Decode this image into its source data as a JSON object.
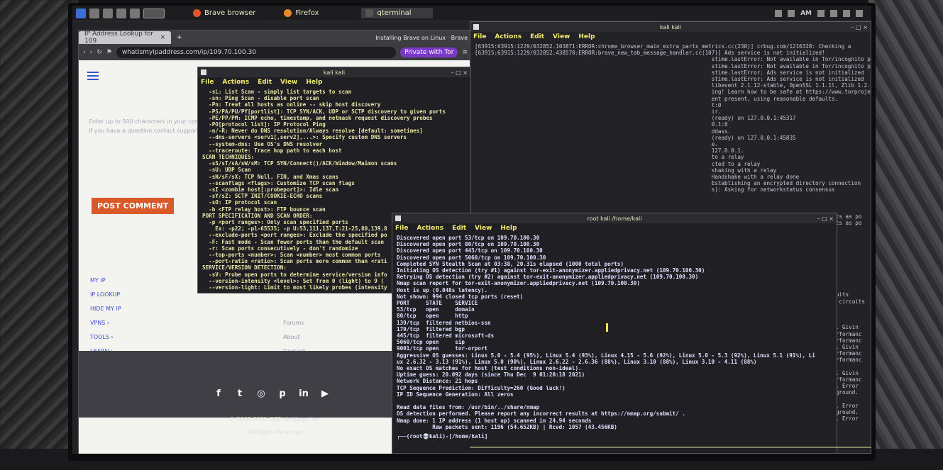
{
  "taskbar": {
    "tasks": [
      {
        "label": "Brave browser",
        "color": "#e2572a"
      },
      {
        "label": "Firefox",
        "color": "#e48a2b"
      },
      {
        "label": "qterminal",
        "color": "#444"
      }
    ],
    "clock": "AM",
    "subtitle": "Installing Brave on Linux · Brave"
  },
  "browser": {
    "tab_title": "IP Address Lookup for 109",
    "url": "whatismyipaddress.com/ip/109.70.100.30",
    "private_label": "Private with Tor",
    "page": {
      "hint_line1": "Enter up to 500 characters in your comment",
      "hint_line2": "If you have a question contact support",
      "post_button": "POST COMMENT",
      "nav": [
        "MY IP",
        "IP LOOKUP",
        "HIDE MY IP",
        "VPNS ›",
        "TOOLS ›",
        "LEARN ›"
      ],
      "nav2": [
        "Forums",
        "About",
        "Contact"
      ],
      "social_icons": [
        "facebook-icon",
        "twitter-icon",
        "instagram-icon",
        "pinterest-icon",
        "linkedin-icon",
        "youtube-icon"
      ],
      "social_glyphs": [
        "f",
        "t",
        "◎",
        "p",
        "in",
        "▶"
      ],
      "copyright": "© 2000-2021 CGP Holdings, Inc.",
      "rights": "All Rights Reserved"
    }
  },
  "terminal_menu": [
    "File",
    "Actions",
    "Edit",
    "View",
    "Help"
  ],
  "term_right": {
    "title": "kali  kali",
    "log": "[63915:63915:1229/032852.103871:ERROR:chrome_browser_main_extra_parts_metrics.cc(230)] crbug.com/1216328: Checking a\n[63915:63915:1229/032852.438570:ERROR:brave_new_tab_message_handler.cc(107)] Ads service is not initialized!\n                                                                         stime.lastError: Not available in Tor/incognito prof\n                                                                         stime.lastError: Not available in Tor/incognito prof\n                                                                         stime.lastError: Ads service is not initialized\n                                                                         stime.lastError: Ads service is not initialized\n                                                                         libevent 2.1.12-stable, OpenSSL 1.1.1l, Zlib 1.2.11\n                                                                         ing! Learn how to be safe at https://www.torproject\n                                                                         ent present, using reasonable defaults.\n                                                                         t:0\n                                                                         ir.\n                                                                         (ready) on 127.0.0.1:45317\n                                                                         0.1:0\n                                                                         ddass.\n                                                                         (ready) on 127.0.0.1:45835\n                                                                         e.\n                                                                         127.0.0.1.\n                                                                         to a relay\n                                                                         cted to a relay\n                                                                         shaking with a relay\n                                                                         Handshake with a relay done\n                                                                         Establishing an encrypted directory connection\n                                                                         s): Asking for networkstatus consensus",
    "side": "ts as po\nts as po\n\n\n\n\n\n\n\n\n\n\nuits\n circuits\n\n\n\n. Givin\nrformanc\nrformanc\n. Givin\nrformanc\nrformanc\n\n. Givin\nrformanc\n. Error\nground.\n\n. Error\nground.\n. Error"
  },
  "term_mid": {
    "body": "  -sL: List Scan - simply list targets to scan\n  -sn: Ping Scan - disable port scan\n  -Pn: Treat all hosts as online -- skip host discovery\n  -PS/PA/PU/PY[portlist]: TCP SYN/ACK, UDP or SCTP discovery to given ports\n  -PE/PP/PM: ICMP echo, timestamp, and netmask request discovery probes\n  -PO[protocol list]: IP Protocol Ping\n  -n/-R: Never do DNS resolution/Always resolve [default: sometimes]\n  --dns-servers <serv1[,serv2],...>: Specify custom DNS servers\n  --system-dns: Use OS's DNS resolver\n  --traceroute: Trace hop path to each host\nSCAN TECHNIQUES:\n  -sS/sT/sA/sW/sM: TCP SYN/Connect()/ACK/Window/Maimon scans\n  -sU: UDP Scan\n  -sN/sF/sX: TCP Null, FIN, and Xmas scans\n  --scanflags <flags>: Customize TCP scan flags\n  -sI <zombie host[:probeport]>: Idle scan\n  -sY/sZ: SCTP INIT/COOKIE-ECHO scans\n  -sO: IP protocol scan\n  -b <FTP relay host>: FTP bounce scan\nPORT SPECIFICATION AND SCAN ORDER:\n  -p <port ranges>: Only scan specified ports\n    Ex: -p22; -p1-65535; -p U:53,111,137,T:21-25,80,139,8\n  --exclude-ports <port ranges>: Exclude the specified po\n  -F: Fast mode - Scan fewer ports than the default scan\n  -r: Scan ports consecutively - don't randomize\n  --top-ports <number>: Scan <number> most common ports\n  --port-ratio <ratio>: Scan ports more common than <rati\nSERVICE/VERSION DETECTION:\n  -sV: Probe open ports to determine service/version info\n  --version-intensity <level>: Set from 0 (light) to 9 (\n  --version-light: Limit to most likely probes (intensity"
  },
  "term_front": {
    "title": "root  kali  /home/kali",
    "body": "Discovered open port 53/tcp on 109.70.100.30\nDiscovered open port 80/tcp on 109.70.100.30\nDiscovered open port 443/tcp on 109.70.100.30\nDiscovered open port 5060/tcp on 109.70.100.30\nCompleted SYN Stealth Scan at 03:38, 20.31s elapsed (1000 total ports)\nInitiating OS detection (try #1) against tor-exit-anonymizer.appliedprivacy.net (109.70.100.30)\nRetrying OS detection (try #2) against tor-exit-anonymizer.appliedprivacy.net (109.70.100.30)\nNmap scan report for tor-exit-anonymizer.appliedprivacy.net (109.70.100.30)\nHost is up (0.048s latency).\nNot shown: 994 closed tcp ports (reset)\nPORT     STATE    SERVICE\n53/tcp   open     domain\n80/tcp   open     http\n139/tcp  filtered netbios-ssn\n179/tcp  filtered bgp\n445/tcp  filtered microsoft-ds\n5060/tcp open     sip\n9001/tcp open     tor-orport\nAggressive OS guesses: Linux 5.0 - 5.4 (95%), Linux 5.4 (93%), Linux 4.15 - 5.6 (92%), Linux 5.0 - 5.3 (92%), Linux 5.1 (91%), Li\nux 2.6.32 - 3.13 (91%), Linux 5.0 (90%), Linux 2.6.22 - 2.6.36 (88%), Linux 3.10 (88%), Linux 3.10 - 4.11 (88%)\nNo exact OS matches for host (test conditions non-ideal).\nUptime guess: 20.092 days (since Thu Dec  9 01:20:18 2021)\nNetwork Distance: 21 hops\nTCP Sequence Prediction: Difficulty=260 (Good luck!)\nIP ID Sequence Generation: All zeros\n\nRead data files from: /usr/bin/../share/nmap\nOS detection performed. Please report any incorrect results at https://nmap.org/submit/ .\nNmap done: 1 IP address (1 host up) scanned in 24.94 seconds\n           Raw packets sent: 1196 (54.652KB) | Rcvd: 1057 (43.456KB)",
    "prompt": "┌──(root💀kali)-[/home/kali]"
  }
}
